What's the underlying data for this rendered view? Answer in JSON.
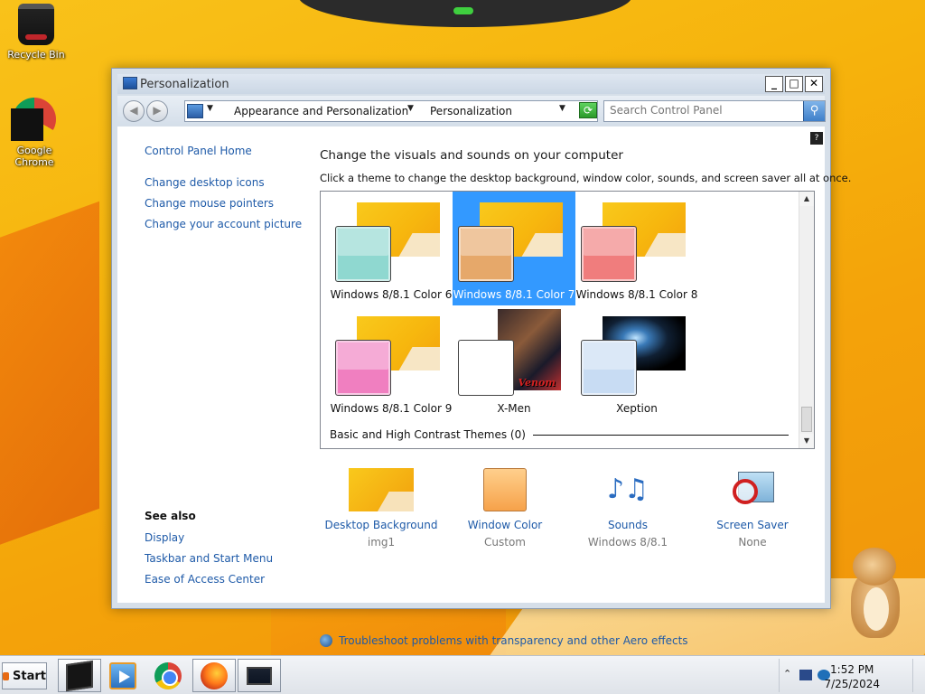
{
  "desktop": {
    "icons": [
      {
        "label": "Recycle Bin",
        "icon": "recycle-bin-icon"
      },
      {
        "label": "Google Chrome",
        "icon": "chrome-icon"
      }
    ]
  },
  "window": {
    "title": "Personalization",
    "controls": {
      "minimize": "_",
      "maximize": "□",
      "close": "✕"
    },
    "address": {
      "back": "◀",
      "forward": "▶",
      "crumbs": [
        "Appearance and Personalization",
        "Personalization"
      ],
      "dropdown_caret": "▼",
      "refresh": "⟳"
    },
    "search": {
      "placeholder": "Search Control Panel",
      "button": "⚲"
    },
    "help": "?"
  },
  "sidebar": {
    "home": "Control Panel Home",
    "links": [
      "Change desktop icons",
      "Change mouse pointers",
      "Change your account picture"
    ],
    "see_also_title": "See also",
    "see_also": [
      "Display",
      "Taskbar and Start Menu",
      "Ease of Access Center"
    ]
  },
  "main": {
    "heading": "Change the visuals and sounds on your computer",
    "subheading": "Click a theme to change the desktop background, window color, sounds, and screen saver all at once.",
    "themes": [
      {
        "label": "Windows 8/8.1 Color 6",
        "swatch": "#8fd8d0",
        "selected": false
      },
      {
        "label": "Windows 8/8.1 Color 7",
        "swatch": "#e6a86a",
        "selected": true
      },
      {
        "label": "Windows 8/8.1 Color 8",
        "swatch": "#f07d7d",
        "selected": false
      },
      {
        "label": "Windows 8/8.1 Color 9",
        "swatch": "#f07fc0",
        "selected": false
      },
      {
        "label": "X-Men",
        "swatch": "#ffffff",
        "selected": false,
        "tag": "Venom"
      },
      {
        "label": "Xeption",
        "swatch": "#c8dcf3",
        "selected": false
      }
    ],
    "basic_section": "Basic and High Contrast Themes (0)",
    "bottom_items": [
      {
        "label": "Desktop Background",
        "sub": "img1",
        "icon": "desktop-background-icon"
      },
      {
        "label": "Window Color",
        "sub": "Custom",
        "icon": "window-color-icon"
      },
      {
        "label": "Sounds",
        "sub": "Windows 8/8.1",
        "icon": "sounds-icon",
        "glyph": "♪♫"
      },
      {
        "label": "Screen Saver",
        "sub": "None",
        "icon": "screen-saver-icon"
      }
    ],
    "troubleshoot": "Troubleshoot problems with transparency and other Aero effects"
  },
  "taskbar": {
    "start": "Start",
    "apps": [
      "terminal",
      "media-center",
      "chrome",
      "firefox",
      "personalization-window"
    ],
    "tray_up": "⌃",
    "time": "1:52 PM",
    "date": "7/25/2024"
  },
  "colors": {
    "link": "#1e5aa8",
    "selection": "#3399ff"
  }
}
